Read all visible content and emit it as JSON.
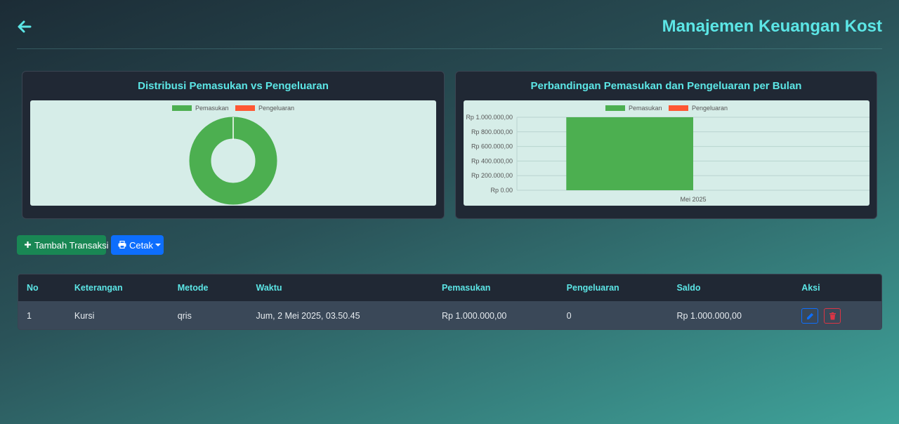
{
  "header": {
    "title": "Manajemen Keuangan Kost",
    "back_icon": "arrow-left-icon"
  },
  "colors": {
    "accent": "#5ce6e6",
    "income": "#4caf50",
    "expense": "#ff5733",
    "success": "#198754",
    "primary": "#0d6efd",
    "danger": "#dc3545"
  },
  "charts": {
    "doughnut_title": "Distribusi Pemasukan vs Pengeluaran",
    "bar_title": "Perbandingan Pemasukan dan Pengeluaran per Bulan"
  },
  "chart_data": [
    {
      "type": "pie",
      "title": "Distribusi Pemasukan vs Pengeluaran",
      "legend": [
        "Pemasukan",
        "Pengeluaran"
      ],
      "values": [
        1000000,
        0
      ],
      "legend_position": "top"
    },
    {
      "type": "bar",
      "title": "Perbandingan Pemasukan dan Pengeluaran per Bulan",
      "categories": [
        "Mei 2025"
      ],
      "series": [
        {
          "name": "Pemasukan",
          "values": [
            1000000
          ]
        },
        {
          "name": "Pengeluaran",
          "values": [
            0
          ]
        }
      ],
      "yticks": [
        "Rp 0.00",
        "Rp 200.000,00",
        "Rp 400.000,00",
        "Rp 600.000,00",
        "Rp 800.000,00",
        "Rp 1.000.000,00"
      ],
      "ylim": [
        0,
        1000000
      ],
      "grid": true,
      "legend_position": "top"
    }
  ],
  "actions": {
    "add_label": "Tambah Transaksi",
    "print_label": "Cetak"
  },
  "table": {
    "columns": [
      "No",
      "Keterangan",
      "Metode",
      "Waktu",
      "Pemasukan",
      "Pengeluaran",
      "Saldo",
      "Aksi"
    ],
    "rows": [
      {
        "no": "1",
        "keterangan": "Kursi",
        "metode": "qris",
        "waktu": "Jum, 2 Mei 2025, 03.50.45",
        "pemasukan": "Rp 1.000.000,00",
        "pengeluaran": "0",
        "saldo": "Rp 1.000.000,00"
      }
    ]
  }
}
